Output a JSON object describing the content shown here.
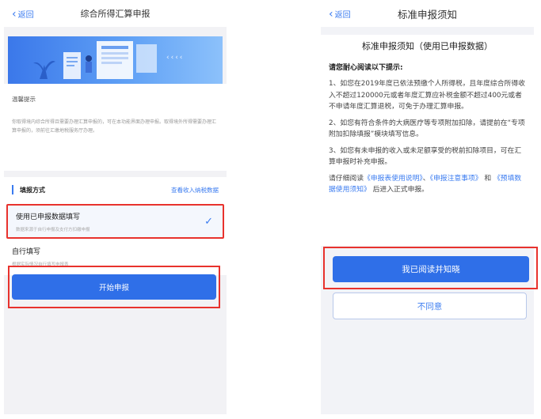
{
  "left": {
    "nav": {
      "back": "返回",
      "title": "综合所得汇算申报"
    },
    "banner": {
      "arrows": "‹‹‹‹"
    },
    "tip": {
      "title": "温馨提示",
      "text": "你取得境内综合所得且需要办理汇算申报的，可在本功能界面办理申报。取得境外所得需要办理汇算申报的，须前往汇缴地税服务厅办理。"
    },
    "method": {
      "label": "填报方式",
      "link": "查看收入纳税数据"
    },
    "options": [
      {
        "title": "使用已申报数据填写",
        "sub": "数据来源于自行申报及支付方扣缴申报",
        "selected": true
      },
      {
        "title": "自行填写",
        "sub": "根据实际情况自行填写申报表",
        "selected": false
      }
    ],
    "start_button": "开始申报"
  },
  "right": {
    "nav": {
      "back": "返回",
      "title": "标准申报须知"
    },
    "notice_title": "标准申报须知（使用已申报数据）",
    "lead": "请您耐心阅读以下提示:",
    "paragraphs": [
      "1、如您在2019年度已依法预缴个人所得税，且年度综合所得收入不超过120000元或者年度汇算应补税金额不超过400元或者不申请年度汇算退税，可免于办理汇算申报。",
      "2、如您有符合条件的大病医疗等专项附加扣除，请提前在“专项附加扣除填报”模块填写信息。",
      "3、如您有未申报的收入或未足额享受的税前扣除项目，可在汇算申报时补充申报。"
    ],
    "read_para": {
      "pre": "请仔细阅读",
      "link1": "《申报表使用说明》",
      "sep": "、",
      "link2": "《申报注意事项》",
      "and": "和",
      "link3": "《预填数据使用须知》",
      "post": "后进入正式申报。"
    },
    "agree_button": "我已阅读并知晓",
    "disagree_button": "不同意"
  },
  "colors": {
    "accent": "#2f6fe8",
    "highlight": "#e8322d"
  }
}
